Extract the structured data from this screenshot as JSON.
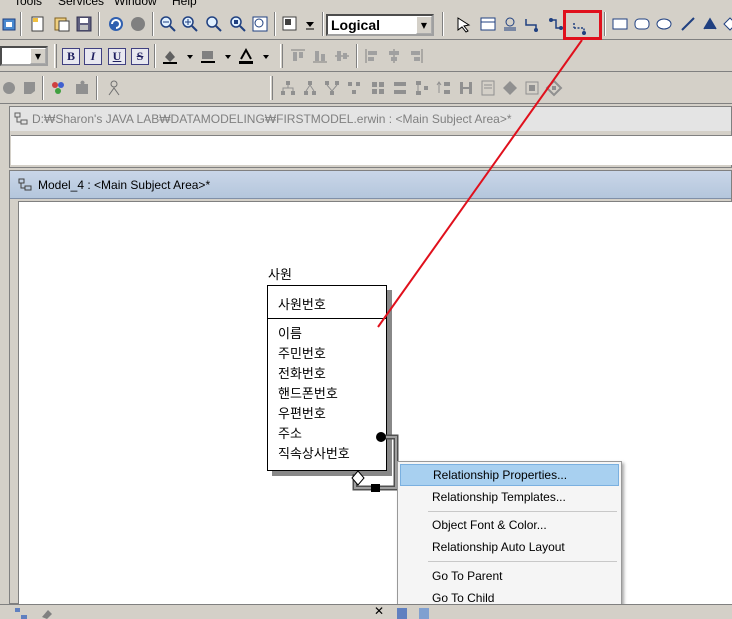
{
  "menubar": {
    "items": [
      "Tools",
      "Services",
      "Window",
      "Help"
    ]
  },
  "toolbar": {
    "view_mode_label": "Logical",
    "format_buttons": [
      "B",
      "I",
      "U",
      "S"
    ],
    "highlighted_tool": "relationship-tool-icon",
    "annotation_color": "#e0101c"
  },
  "document1": {
    "title": "D:₩Sharon's JAVA LAB₩DATAMODELING₩FIRSTMODEL.erwin : <Main Subject Area>*"
  },
  "document2": {
    "title": "Model_4 : <Main Subject Area>*"
  },
  "entity": {
    "name": "사원",
    "primary_key": "사원번호",
    "attributes": [
      "이름",
      "주민번호",
      "전화번호",
      "핸드폰번호",
      "우편번호",
      "주소",
      "직속상사번호"
    ]
  },
  "context_menu": {
    "groups": [
      [
        "Relationship Properties...",
        "Relationship Templates..."
      ],
      [
        "Object Font & Color...",
        "Relationship Auto Layout"
      ],
      [
        "Go To Parent",
        "Go To Child"
      ]
    ]
  }
}
